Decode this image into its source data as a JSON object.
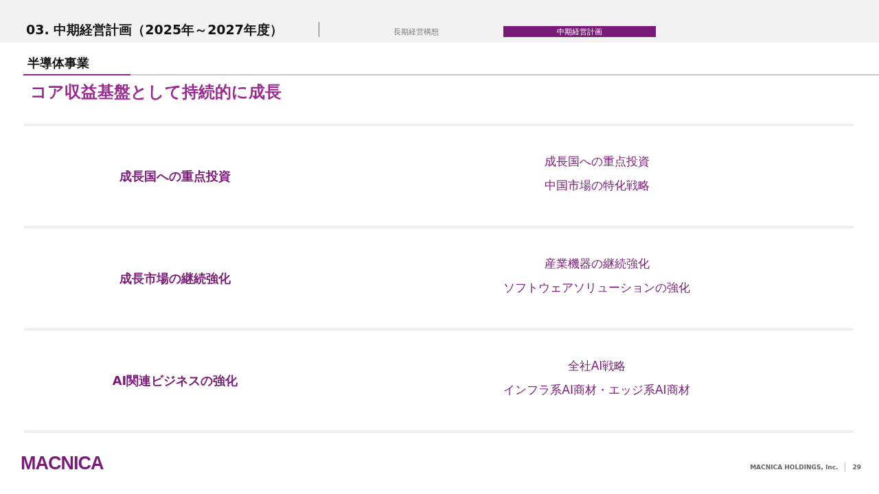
{
  "header": {
    "title": "03. 中期経営計画（2025年～2027年度）",
    "tabs": [
      {
        "label": "長期経営構想",
        "selected": false
      },
      {
        "label": "中期経営計画",
        "selected": true
      }
    ]
  },
  "section": {
    "label": "半導体事業",
    "headline": "コア収益基盤として持続的に成長"
  },
  "rows": [
    {
      "theme": "成長国への重点投資",
      "items": [
        "成長国への重点投資",
        "中国市場の特化戦略"
      ]
    },
    {
      "theme": "成長市場の継続強化",
      "items": [
        "産業機器の継続強化",
        "ソフトウェアソリューションの強化"
      ]
    },
    {
      "theme": "AI関連ビジネスの強化",
      "items": [
        "全社AI戦略",
        "インフラ系AI商材・エッジ系AI商材"
      ]
    }
  ],
  "footer": {
    "logo": "MACNICA",
    "company": "MACNICA HOLDINGS, Inc.",
    "page": "29"
  }
}
